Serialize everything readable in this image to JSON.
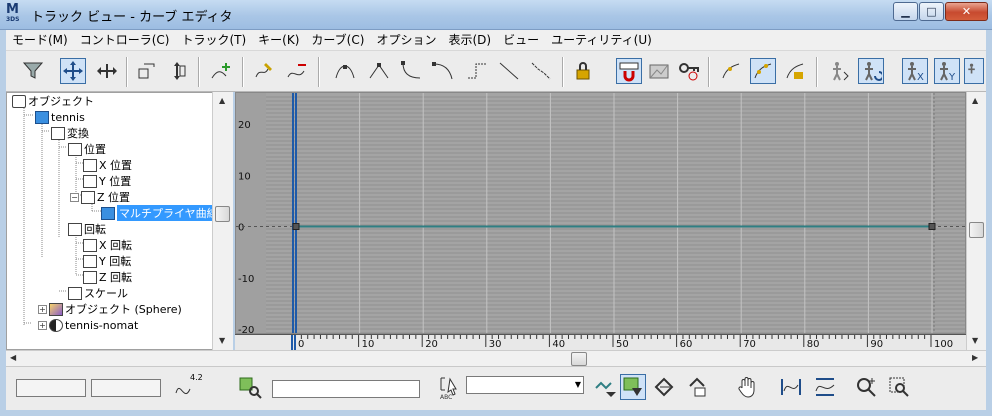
{
  "window": {
    "title": "トラック ビュー - カーブ エディタ",
    "app_icon_text": "M",
    "app_icon_sub": "3DS"
  },
  "menu": [
    "モード(M)",
    "コントローラ(C)",
    "トラック(T)",
    "キー(K)",
    "カーブ(C)",
    "オプション",
    "表示(D)",
    "ビュー",
    "ユーティリティ(U)"
  ],
  "tree": {
    "items": [
      {
        "label": "オブジェクト",
        "icon": "objects-icon"
      },
      {
        "label": "tennis",
        "icon": "object-box-icon"
      },
      {
        "label": "変換",
        "icon": "transform-icon"
      },
      {
        "label": "位置",
        "icon": "position-icon"
      },
      {
        "label": "X 位置",
        "icon": "curve-icon"
      },
      {
        "label": "Y 位置",
        "icon": "curve-icon"
      },
      {
        "label": "Z 位置",
        "icon": "curve-icon"
      },
      {
        "label": "マルチプライヤ曲線",
        "icon": "multiplier-curve-icon",
        "selected": true
      },
      {
        "label": "回転",
        "icon": "rotation-icon"
      },
      {
        "label": "X 回転",
        "icon": "curve-icon"
      },
      {
        "label": "Y 回転",
        "icon": "curve-icon"
      },
      {
        "label": "Z 回転",
        "icon": "curve-icon"
      },
      {
        "label": "スケール",
        "icon": "scale-icon"
      },
      {
        "label": "オブジェクト (Sphere)",
        "icon": "sphere-object-icon"
      },
      {
        "label": "tennis-nomat",
        "icon": "material-icon"
      }
    ]
  },
  "graph": {
    "y_ticks": [
      "20",
      "10",
      "0",
      "-10",
      "-20"
    ],
    "x_ticks": [
      "0",
      "10",
      "20",
      "30",
      "40",
      "50",
      "60",
      "70",
      "80",
      "90",
      "100"
    ],
    "curve_value": 0,
    "key_start_frame": 0,
    "key_end_frame": 100,
    "colors": {
      "background": "#a4a4a4",
      "grid_line": "#8f8f8f",
      "curve": "#2f7f83",
      "time_slider": "#1e5aa8"
    }
  },
  "status": {
    "value_readout": "4.2",
    "combo_value": ""
  }
}
